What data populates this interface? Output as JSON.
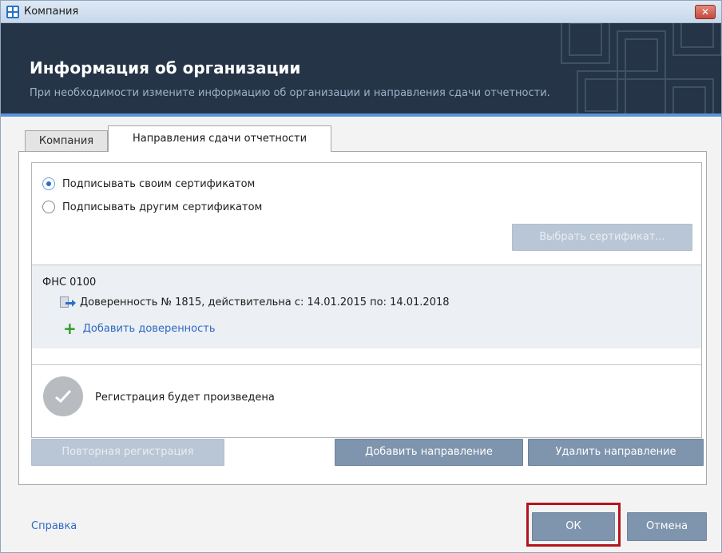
{
  "window": {
    "title": "Компания",
    "close_glyph": "✕"
  },
  "header": {
    "title": "Информация об организации",
    "subtitle": "При необходимости измените информацию об организации и направления сдачи отчетности."
  },
  "tabs": [
    {
      "label": "Компания",
      "active": false
    },
    {
      "label": "Направления сдачи отчетности",
      "active": true
    }
  ],
  "signing": {
    "options": [
      {
        "label": "Подписывать своим сертификатом",
        "checked": true
      },
      {
        "label": "Подписывать другим сертификатом",
        "checked": false
      }
    ],
    "select_cert_button": "Выбрать сертификат..."
  },
  "direction": {
    "title": "ФНС 0100",
    "power_of_attorney": "Доверенность № 1815, действительна с: 14.01.2015 по: 14.01.2018",
    "add_power_of_attorney": "Добавить доверенность"
  },
  "registration": {
    "status": "Регистрация будет произведена"
  },
  "buttons": {
    "re_register": "Повторная регистрация",
    "add_direction": "Добавить направление",
    "remove_direction": "Удалить направление",
    "ok": "ОК",
    "cancel": "Отмена"
  },
  "footer": {
    "help": "Справка"
  },
  "icons": {
    "app": "app-grid-icon",
    "close": "close-icon",
    "document": "power-of-attorney-document-icon",
    "add": "plus-icon",
    "check": "check-icon"
  },
  "colors": {
    "header_bg": "#253447",
    "accent": "#5d93d8",
    "primary_button": "#7f94ad",
    "link": "#2d69c2",
    "highlight": "#b3141c"
  }
}
